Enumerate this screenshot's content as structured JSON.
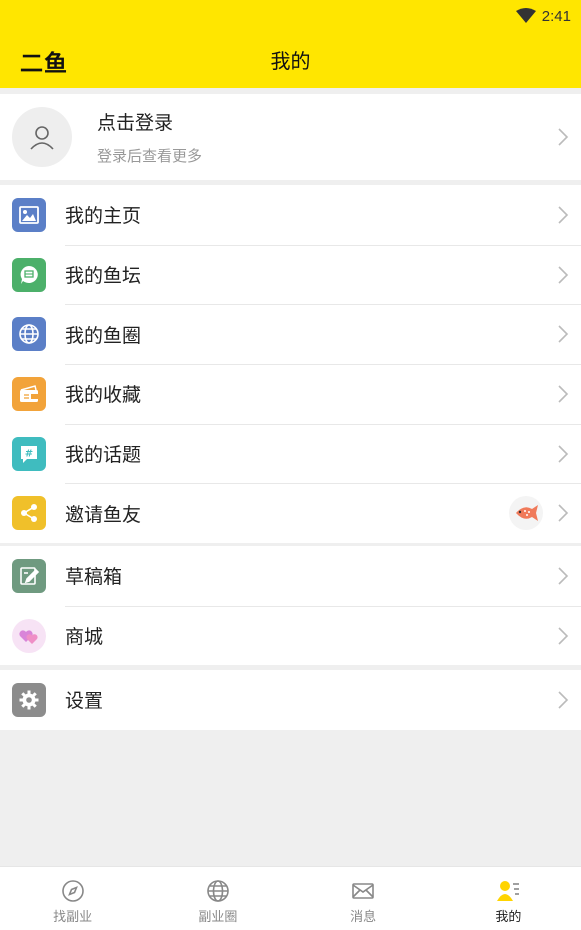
{
  "status": {
    "time": "2:41"
  },
  "header": {
    "logo": "二鱼",
    "title": "我的"
  },
  "login": {
    "title": "点击登录",
    "subtitle": "登录后查看更多"
  },
  "menu_group1": [
    {
      "label": "我的主页",
      "icon": "image-icon",
      "color": "#5b7fc7"
    },
    {
      "label": "我的鱼坛",
      "icon": "chat-bubble-icon",
      "color": "#4cb06a"
    },
    {
      "label": "我的鱼圈",
      "icon": "globe-icon",
      "color": "#5b7fc7"
    },
    {
      "label": "我的收藏",
      "icon": "wallet-icon",
      "color": "#f2a33a"
    },
    {
      "label": "我的话题",
      "icon": "hashtag-icon",
      "color": "#3fbcbf"
    },
    {
      "label": "邀请鱼友",
      "icon": "share-icon",
      "color": "#f0c02a"
    }
  ],
  "menu_group2": [
    {
      "label": "草稿箱",
      "icon": "draft-icon",
      "color": "#6f9a80"
    },
    {
      "label": "商城",
      "icon": "hearts-icon",
      "color": "#f7e3f5"
    }
  ],
  "menu_group3": [
    {
      "label": "设置",
      "icon": "gear-icon",
      "color": "#8c8c8c"
    }
  ],
  "tabs": [
    {
      "label": "找副业",
      "icon": "compass-icon",
      "active": false
    },
    {
      "label": "副业圈",
      "icon": "globe-icon",
      "active": false
    },
    {
      "label": "消息",
      "icon": "envelope-icon",
      "active": false
    },
    {
      "label": "我的",
      "icon": "profile-icon",
      "active": true
    }
  ]
}
